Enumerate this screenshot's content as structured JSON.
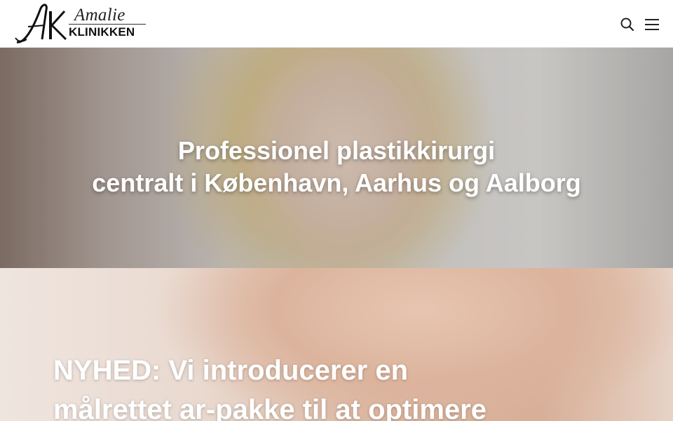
{
  "header": {
    "logo": {
      "script_text": "Amalie",
      "word_text": "KLINIKKEN",
      "monogram": "AK"
    },
    "search_icon": "search-icon",
    "menu_icon": "hamburger-menu-icon"
  },
  "hero": {
    "line1": "Professionel plastikkirurgi",
    "line2": "centralt i København, Aarhus og Aalborg"
  },
  "promo": {
    "line1": "NYHED: Vi introducerer en",
    "line2": "målrettet ar-pakke til at optimere"
  },
  "colors": {
    "header_bg": "#ffffff",
    "text_on_image": "#ffffff",
    "logo_ink": "#111111"
  }
}
